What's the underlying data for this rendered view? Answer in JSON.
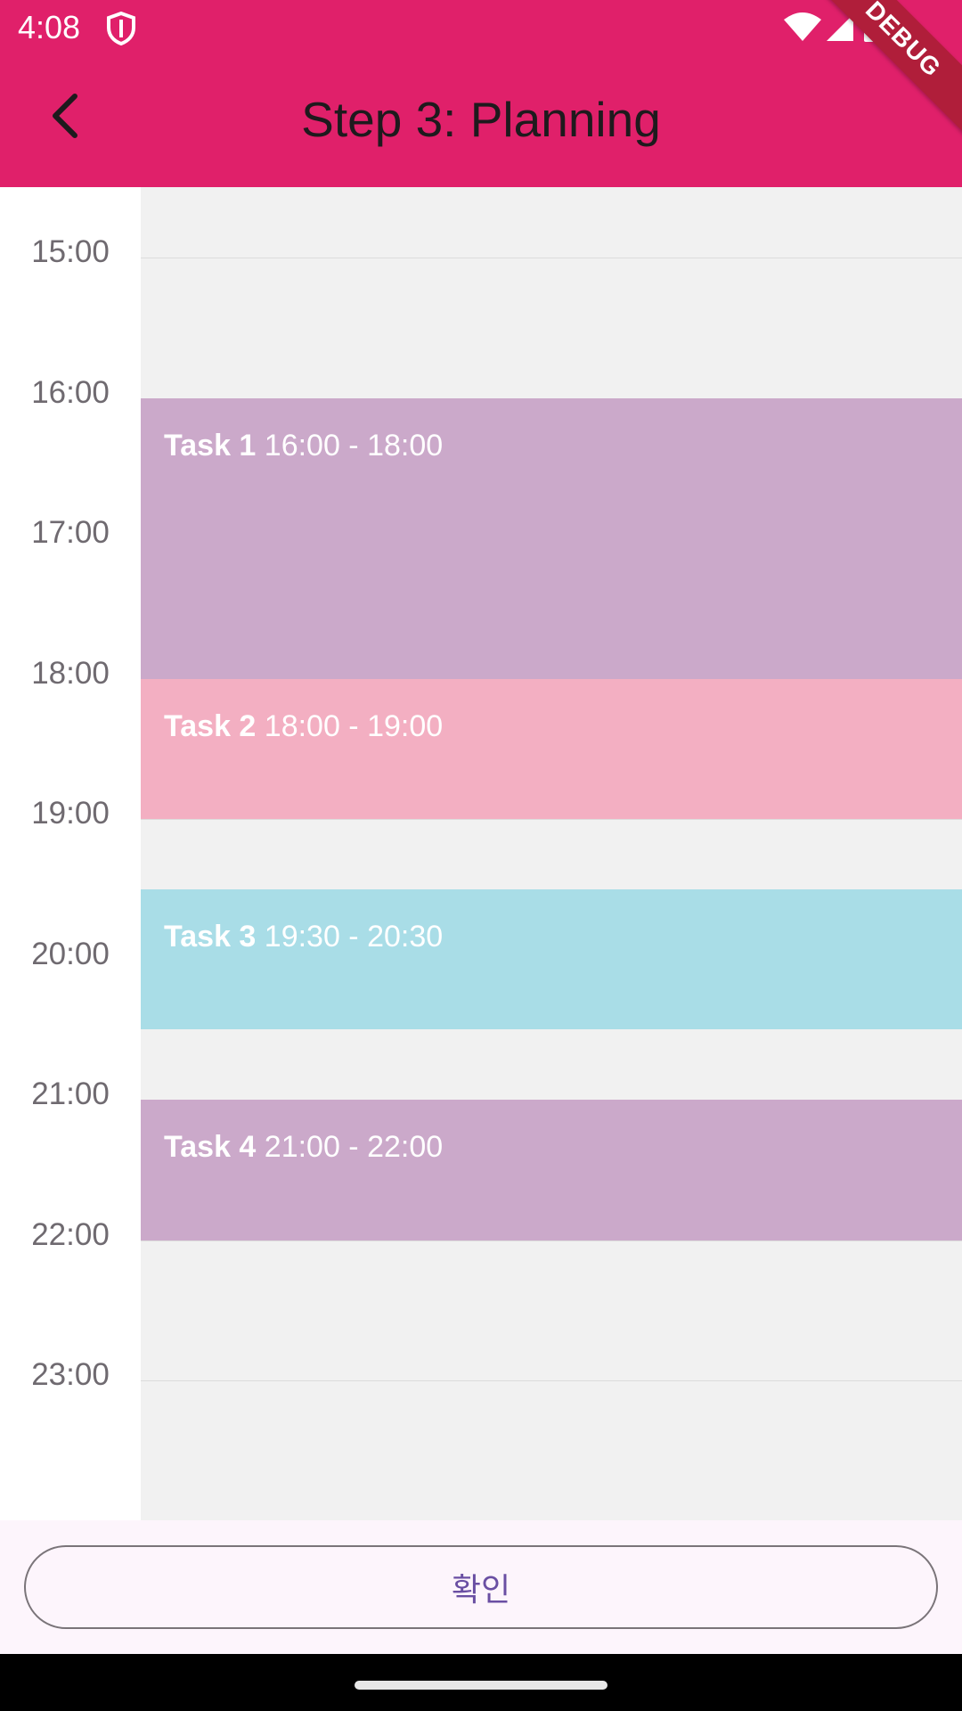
{
  "status_bar": {
    "time": "4:08",
    "shield_icon": "shield-icon",
    "wifi_icon": "wifi-icon",
    "signal_icon": "signal-icon",
    "battery_icon": "battery-icon"
  },
  "debug_banner": "DEBUG",
  "app_bar": {
    "title": "Step 3: Planning",
    "back_icon": "back-arrow-icon",
    "background_color": "#E0206A"
  },
  "timeline": {
    "hours": [
      "15:00",
      "16:00",
      "17:00",
      "18:00",
      "19:00",
      "20:00",
      "21:00",
      "22:00",
      "23:00"
    ],
    "events": [
      {
        "name": "Task 1",
        "time": "16:00 - 18:00",
        "start": "16:00",
        "end": "18:00",
        "color": "#CBA9CA"
      },
      {
        "name": "Task 2",
        "time": "18:00 - 19:00",
        "start": "18:00",
        "end": "19:00",
        "color": "#F3AFC2"
      },
      {
        "name": "Task 3",
        "time": "19:30 - 20:30",
        "start": "19:30",
        "end": "20:30",
        "color": "#A9DDE7"
      },
      {
        "name": "Task 4",
        "time": "21:00 - 22:00",
        "start": "21:00",
        "end": "22:00",
        "color": "#CBA9CA"
      }
    ]
  },
  "bottom": {
    "confirm_label": "확인"
  }
}
